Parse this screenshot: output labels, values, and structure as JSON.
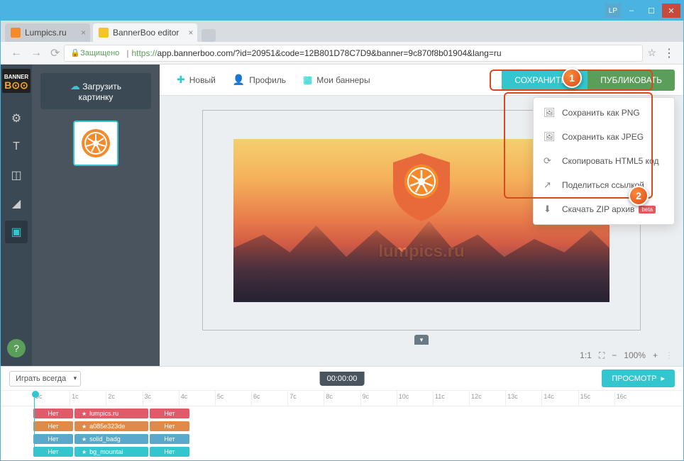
{
  "window": {
    "lp": "LP"
  },
  "tabs": [
    {
      "title": "Lumpics.ru",
      "active": false,
      "favicon": "#f58a2a"
    },
    {
      "title": "BannerBoo editor",
      "active": true,
      "favicon": "#f5c32a"
    }
  ],
  "addr": {
    "secure": "Защищено",
    "url_prefix": "https://",
    "url": "app.bannerboo.com/?id=20951&code=12B801D78C7D9&banner=9c870f8b01904&lang=ru"
  },
  "topbar": {
    "new": "Новый",
    "profile": "Профиль",
    "banners": "Мои баннеры",
    "save": "СОХРАНИТЬ",
    "publish": "ПУБЛИКОВАТЬ"
  },
  "upload": {
    "line1": "Загрузить",
    "line2": "картинку"
  },
  "dropdown": [
    {
      "icon": "🖼",
      "label": "Сохранить как PNG"
    },
    {
      "icon": "🖼",
      "label": "Сохранить как JPEG"
    },
    {
      "icon": "⟳",
      "label": "Скопировать HTML5 код"
    },
    {
      "icon": "↗",
      "label": "Поделиться ссылкой"
    },
    {
      "icon": "⬇",
      "label": "Скачать ZIP архив",
      "beta": "beta"
    }
  ],
  "banner": {
    "text": "lumpics.ru"
  },
  "zoom": {
    "ratio": "1:1",
    "percent": "100%"
  },
  "timeline": {
    "play_mode": "Играть всегда",
    "time": "00:00:00",
    "preview": "ПРОСМОТР",
    "ticks": [
      "0c",
      "1c",
      "2c",
      "3c",
      "4c",
      "5c",
      "6c",
      "7c",
      "8c",
      "9c",
      "10c",
      "11c",
      "12c",
      "13c",
      "14c",
      "15c",
      "16c"
    ],
    "rows": [
      {
        "c1": "Нет",
        "label": "lumpics.ru",
        "c3": "Нет",
        "color": "#e05a6a"
      },
      {
        "c1": "Нет",
        "label": "a085e323de",
        "c3": "Нет",
        "color": "#e08a4a"
      },
      {
        "c1": "Нет",
        "label": "solid_badg",
        "c3": "Нет",
        "color": "#5aa8cc"
      },
      {
        "c1": "Нет",
        "label": "bg_mountai",
        "c3": "Нет",
        "color": "#34c6cf"
      }
    ]
  },
  "callout": {
    "one": "1",
    "two": "2"
  }
}
